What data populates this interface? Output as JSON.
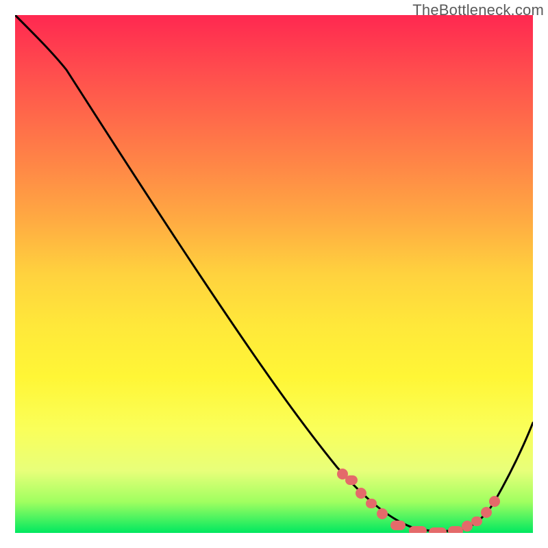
{
  "watermark": "TheBottleneck.com",
  "chart_data": {
    "type": "line",
    "title": "",
    "xlabel": "",
    "ylabel": "",
    "xlim": [
      0,
      100
    ],
    "ylim": [
      0,
      100
    ],
    "grid": false,
    "legend": false,
    "series": [
      {
        "name": "curve",
        "x": [
          0,
          5,
          10,
          15,
          20,
          25,
          30,
          35,
          40,
          45,
          50,
          55,
          60,
          62,
          65,
          68,
          70,
          73,
          76,
          79,
          82,
          85,
          88,
          90,
          93,
          96,
          100
        ],
        "y": [
          100,
          97,
          93,
          88,
          82,
          76,
          69,
          62,
          55,
          48,
          41,
          34,
          27,
          23,
          18,
          13,
          9,
          5,
          2,
          0,
          0,
          0,
          1,
          3,
          7,
          13,
          24
        ]
      }
    ],
    "markers": [
      {
        "x": 63,
        "y": 19
      },
      {
        "x": 65,
        "y": 15
      },
      {
        "x": 69,
        "y": 8
      },
      {
        "x": 72,
        "y": 4
      },
      {
        "x": 76,
        "y": 1
      },
      {
        "x": 79,
        "y": 0
      },
      {
        "x": 82,
        "y": 0
      },
      {
        "x": 85,
        "y": 0
      },
      {
        "x": 88,
        "y": 1
      },
      {
        "x": 90,
        "y": 3
      },
      {
        "x": 92,
        "y": 6
      }
    ],
    "colors": {
      "top": "#ff2850",
      "mid": "#ffe83a",
      "bottom": "#00e860",
      "marker": "#e46a6a"
    }
  }
}
